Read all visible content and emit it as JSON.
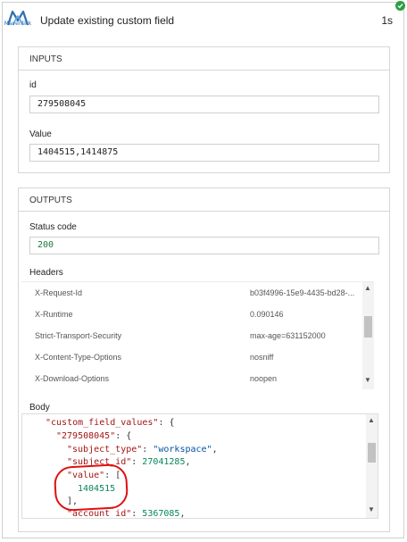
{
  "header": {
    "logo_text": "Mavenlink",
    "title": "Update existing custom field",
    "duration": "1s",
    "status_icon": "check-circle-icon",
    "status_color": "#2e9e44"
  },
  "inputs": {
    "section_title": "INPUTS",
    "id_label": "id",
    "id_value": "279508045",
    "value_label": "Value",
    "value_value": "1404515,1414875"
  },
  "outputs": {
    "section_title": "OUTPUTS",
    "status_label": "Status code",
    "status_value": "200",
    "headers_label": "Headers",
    "headers": [
      {
        "key": "X-Request-Id",
        "value": "b03f4996-15e9-4435-bd28-..."
      },
      {
        "key": "X-Runtime",
        "value": "0.090146"
      },
      {
        "key": "Strict-Transport-Security",
        "value": "max-age=631152000"
      },
      {
        "key": "X-Content-Type-Options",
        "value": "nosniff"
      },
      {
        "key": "X-Download-Options",
        "value": "noopen"
      }
    ],
    "body_label": "Body",
    "body_lines": [
      {
        "key": "\"custom_field_values\"",
        "rest": ": {"
      },
      {
        "key": "\"279508045\"",
        "rest": ": {"
      },
      {
        "key": "\"subject_type\"",
        "sep": ": ",
        "val": "\"workspace\"",
        "end": ","
      },
      {
        "key": "\"subject_id\"",
        "sep": ": ",
        "num": "27041285",
        "end": ","
      },
      {
        "key": "\"value\"",
        "rest": ": ["
      },
      {
        "num_only": "1404515"
      },
      {
        "punct": "],"
      },
      {
        "key": "\"account_id\"",
        "sep": ": ",
        "num": "5367085",
        "end": ","
      }
    ]
  },
  "colors": {
    "annotation": "#e01010",
    "number": "#098658",
    "key": "#a31515",
    "string": "#0451a5"
  }
}
